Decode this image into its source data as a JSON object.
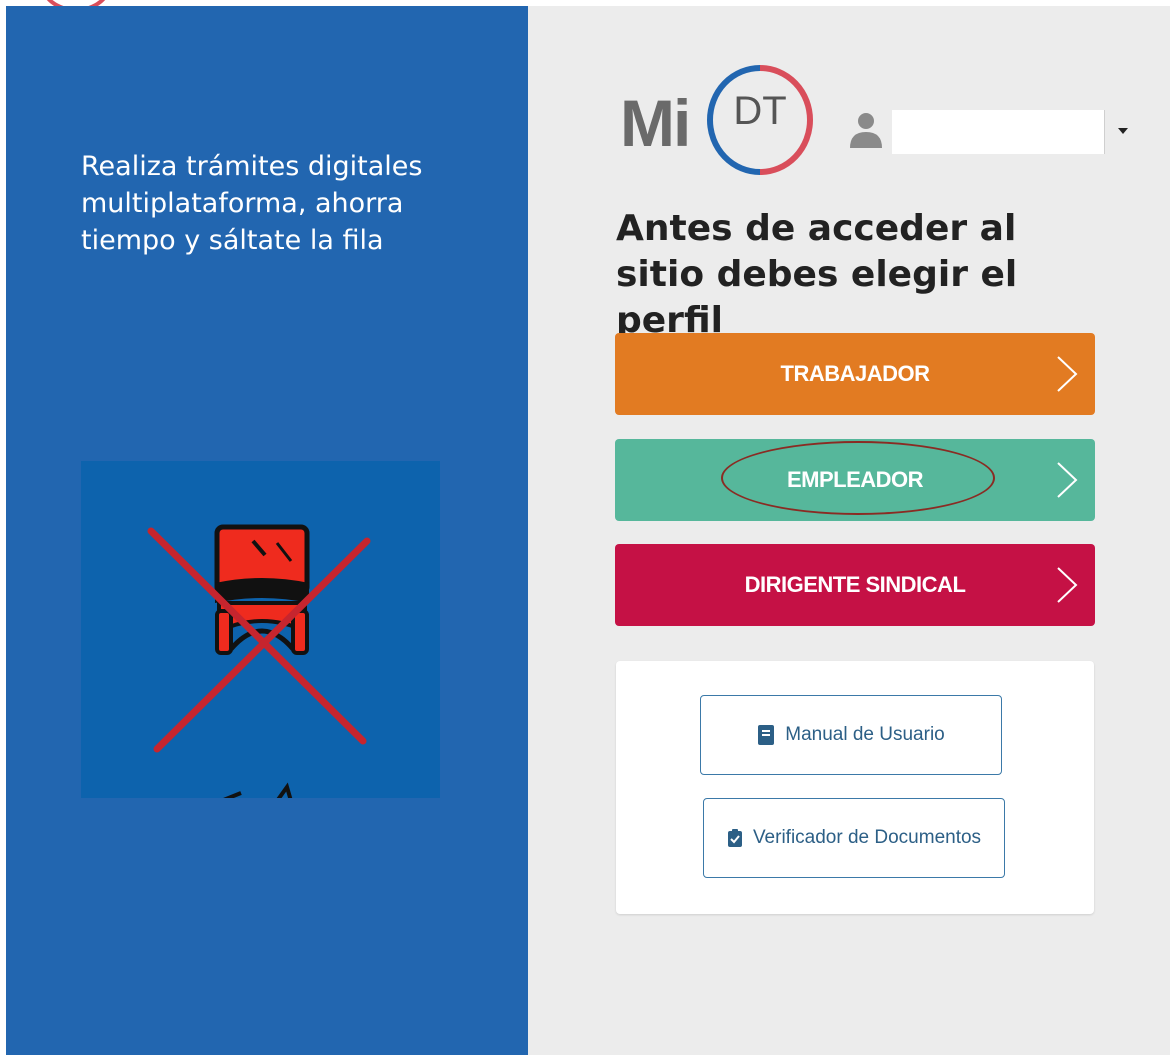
{
  "left_panel": {
    "tagline": "Realiza trámites digitales multiplataforma, ahorra tiempo y sáltate la fila",
    "illustration_icon": "crossed-out-queue-chair"
  },
  "brand": {
    "mi": "Mi",
    "dt": "DT",
    "colors": {
      "blue": "#2266b0",
      "red": "#d94e5b",
      "gray": "#6a6a6a"
    }
  },
  "user_select": {
    "icon": "user-icon",
    "value": ""
  },
  "heading": "Antes de acceder al sitio debes elegir el perfil",
  "profiles": {
    "trabajador": {
      "label": "TRABAJADOR",
      "color": "#e27b22"
    },
    "empleador": {
      "label": "EMPLEADOR",
      "color": "#56b79b"
    },
    "dirigente": {
      "label": "DIRIGENTE SINDICAL",
      "color": "#c51145"
    }
  },
  "links": {
    "manual": {
      "label": "Manual de Usuario",
      "icon": "book-icon"
    },
    "verificador": {
      "label": "Verificador de Documentos",
      "icon": "clipboard-check-icon"
    }
  }
}
